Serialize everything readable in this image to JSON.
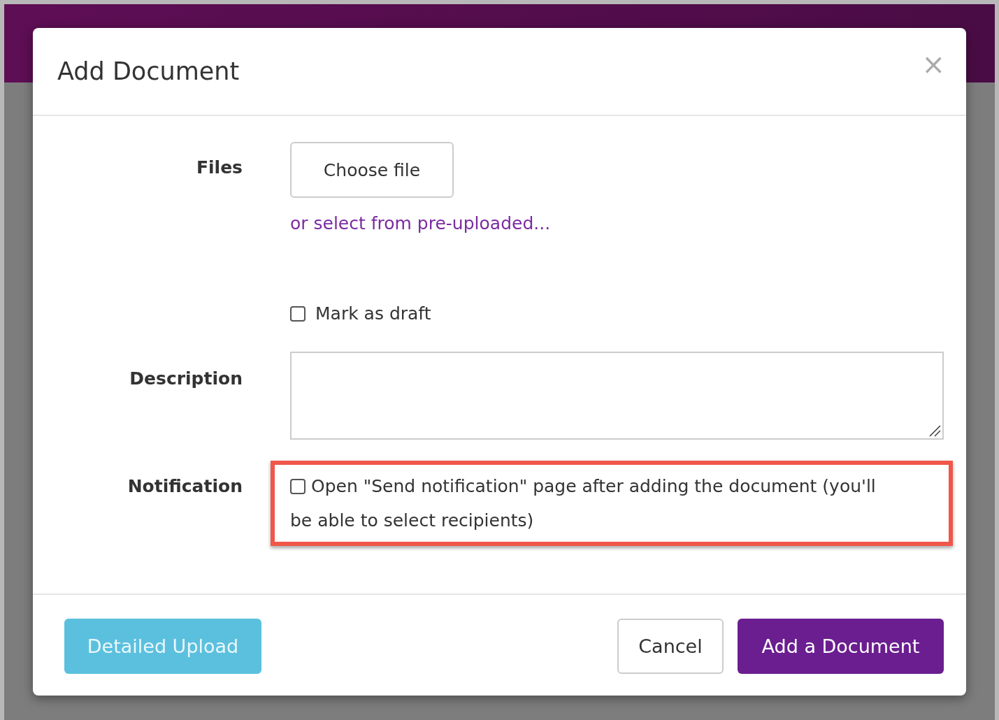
{
  "modal": {
    "title": "Add Document",
    "close": "×",
    "fields": [
      {
        "kind": "file",
        "label": "Files",
        "button": "Choose file",
        "link": "or select from pre-uploaded..."
      },
      {
        "kind": "checkbox",
        "text": "Mark as draft",
        "checked": false,
        "highlighted": false
      },
      {
        "kind": "textarea",
        "label": "Description"
      },
      {
        "kind": "checkbox",
        "label": "Notification",
        "text": "Open \"Send notification\" page after adding the document (you'll be able to select recipients)",
        "checked": false,
        "highlighted": true
      }
    ],
    "footer": [
      {
        "kind": "info",
        "label": "Detailed Upload"
      },
      {
        "kind": "default",
        "label": "Cancel"
      },
      {
        "kind": "primary",
        "label": "Add a Document"
      }
    ]
  }
}
